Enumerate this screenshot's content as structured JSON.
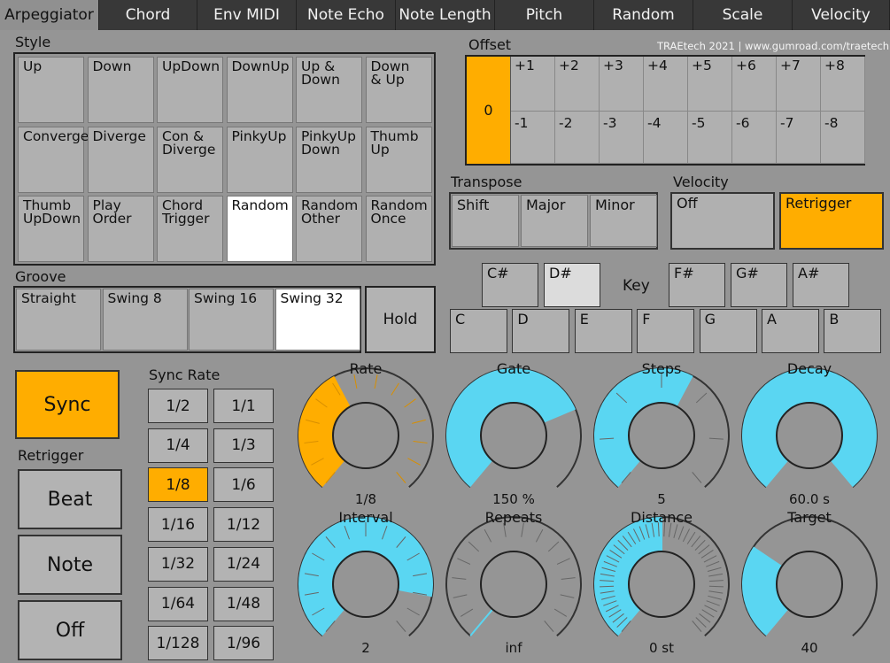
{
  "tabs": [
    "Arpeggiator",
    "Chord",
    "Env MIDI",
    "Note Echo",
    "Note Length",
    "Pitch",
    "Random",
    "Scale",
    "Velocity"
  ],
  "credit": "TRAEtech 2021  |  www.gumroad.com/traetech",
  "style": {
    "label": "Style",
    "items": [
      {
        "text": "Up",
        "selected": false
      },
      {
        "text": "Down",
        "selected": false
      },
      {
        "text": "UpDown",
        "selected": false
      },
      {
        "text": "DownUp",
        "selected": false
      },
      {
        "text": "Up &\nDown",
        "selected": false
      },
      {
        "text": "Down\n& Up",
        "selected": false
      },
      {
        "text": "Converge",
        "selected": false
      },
      {
        "text": "Diverge",
        "selected": false
      },
      {
        "text": "Con &\nDiverge",
        "selected": false
      },
      {
        "text": "PinkyUp",
        "selected": false
      },
      {
        "text": "PinkyUp\nDown",
        "selected": false
      },
      {
        "text": "Thumb\nUp",
        "selected": false
      },
      {
        "text": "Thumb\nUpDown",
        "selected": false
      },
      {
        "text": "Play\nOrder",
        "selected": false
      },
      {
        "text": "Chord\nTrigger",
        "selected": false
      },
      {
        "text": "Random",
        "selected": true
      },
      {
        "text": "Random\nOther",
        "selected": false
      },
      {
        "text": "Random\nOnce",
        "selected": false
      }
    ]
  },
  "groove": {
    "label": "Groove",
    "items": [
      {
        "text": "Straight",
        "selected": false
      },
      {
        "text": "Swing 8",
        "selected": false
      },
      {
        "text": "Swing 16",
        "selected": false
      },
      {
        "text": "Swing 32",
        "selected": true
      }
    ],
    "hold": "Hold"
  },
  "offset": {
    "label": "Offset",
    "zero": "0",
    "top": [
      "+1",
      "+2",
      "+3",
      "+4",
      "+5",
      "+6",
      "+7",
      "+8"
    ],
    "bottom": [
      "-1",
      "-2",
      "-3",
      "-4",
      "-5",
      "-6",
      "-7",
      "-8"
    ]
  },
  "transpose": {
    "label": "Transpose",
    "items": [
      {
        "text": "Shift",
        "selected": false
      },
      {
        "text": "Major",
        "selected": false
      },
      {
        "text": "Minor",
        "selected": false
      }
    ]
  },
  "velocity": {
    "label": "Velocity",
    "items": [
      {
        "text": "Off",
        "selected": false
      },
      {
        "text": "Retrigger",
        "selected": true
      }
    ]
  },
  "key": {
    "label": "Key",
    "sharps": [
      {
        "text": "C#",
        "selected": false
      },
      {
        "text": "D#",
        "selected": true
      },
      {
        "text": "F#",
        "selected": false
      },
      {
        "text": "G#",
        "selected": false
      },
      {
        "text": "A#",
        "selected": false
      }
    ],
    "naturals": [
      {
        "text": "C",
        "selected": false
      },
      {
        "text": "D",
        "selected": false
      },
      {
        "text": "E",
        "selected": false
      },
      {
        "text": "F",
        "selected": false
      },
      {
        "text": "G",
        "selected": false
      },
      {
        "text": "A",
        "selected": false
      },
      {
        "text": "B",
        "selected": false
      }
    ]
  },
  "sync": {
    "label": "Sync",
    "active": true
  },
  "retrigger": {
    "label": "Retrigger",
    "items": [
      {
        "text": "Beat",
        "selected": false
      },
      {
        "text": "Note",
        "selected": false
      },
      {
        "text": "Off",
        "selected": false
      }
    ]
  },
  "sync_rate": {
    "label": "Sync Rate",
    "items": [
      {
        "text": "1/2",
        "selected": false
      },
      {
        "text": "1/1",
        "selected": false
      },
      {
        "text": "1/4",
        "selected": false
      },
      {
        "text": "1/3",
        "selected": false
      },
      {
        "text": "1/8",
        "selected": true
      },
      {
        "text": "1/6",
        "selected": false
      },
      {
        "text": "1/16",
        "selected": false
      },
      {
        "text": "1/12",
        "selected": false
      },
      {
        "text": "1/32",
        "selected": false
      },
      {
        "text": "1/24",
        "selected": false
      },
      {
        "text": "1/64",
        "selected": false
      },
      {
        "text": "1/48",
        "selected": false
      },
      {
        "text": "1/128",
        "selected": false
      },
      {
        "text": "1/96",
        "selected": false
      }
    ]
  },
  "colors": {
    "orange": "#ffad00",
    "cyan": "#5ad6f2",
    "knob_track": "#8e8e8e"
  },
  "knobs": [
    {
      "name": "Rate",
      "value": "1/8",
      "level": 0.4,
      "color": "orange",
      "ticks": 14,
      "pointer": false
    },
    {
      "name": "Gate",
      "value": "150 %",
      "level": 0.74,
      "color": "cyan",
      "ticks": 0,
      "pointer": false
    },
    {
      "name": "Steps",
      "value": "5",
      "level": 0.6,
      "color": "cyan",
      "ticks": 7,
      "pointer": false
    },
    {
      "name": "Decay",
      "value": "60.0 s",
      "level": 1.0,
      "color": "cyan",
      "ticks": 0,
      "pointer": false
    },
    {
      "name": "Interval",
      "value": "2",
      "level": 0.86,
      "color": "cyan",
      "ticks": 15,
      "pointer": false
    },
    {
      "name": "Repeats",
      "value": "inf",
      "level": 0.0,
      "color": "cyan",
      "ticks": 16,
      "pointer": true
    },
    {
      "name": "Distance",
      "value": "0 st",
      "level": 0.5,
      "color": "cyan",
      "ticks": 48,
      "pointer": true
    },
    {
      "name": "Target",
      "value": "40",
      "level": 0.3,
      "color": "cyan",
      "ticks": 0,
      "pointer": false
    }
  ]
}
